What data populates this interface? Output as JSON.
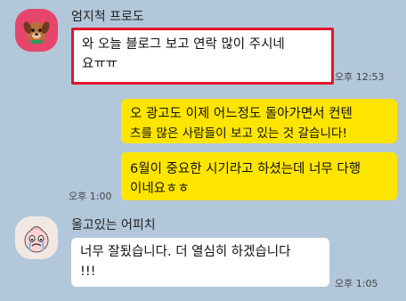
{
  "messages": [
    {
      "sender": "엄지척 프로도",
      "avatar_icon": "frodo-dog-icon",
      "lines": [
        "와 오늘 블로그 보고 연락 많이 주시네",
        "요ㅠㅠ"
      ],
      "time": "오후 12:53"
    },
    {
      "lines": [
        "오 광고도 이제 어느정도 돌아가면서 컨텐",
        "츠를 많은 사람들이 보고 있는 것 갈습니다!"
      ]
    },
    {
      "lines": [
        "6월이 중요한 시기라고 하셨는데 너무 다행",
        "이네요ㅎㅎ"
      ],
      "time": "오후 1:00"
    },
    {
      "sender": "울고있는 어피치",
      "avatar_icon": "crying-apeach-icon",
      "lines": [
        "너무 잘됬습니다. 더 열심히 하겠습니다",
        "!!!"
      ],
      "time": "오후 1:05"
    }
  ],
  "colors": {
    "background": "#b2c7da",
    "outgoing": "#fee500",
    "incoming": "#ffffff",
    "highlight": "#e0162b"
  }
}
